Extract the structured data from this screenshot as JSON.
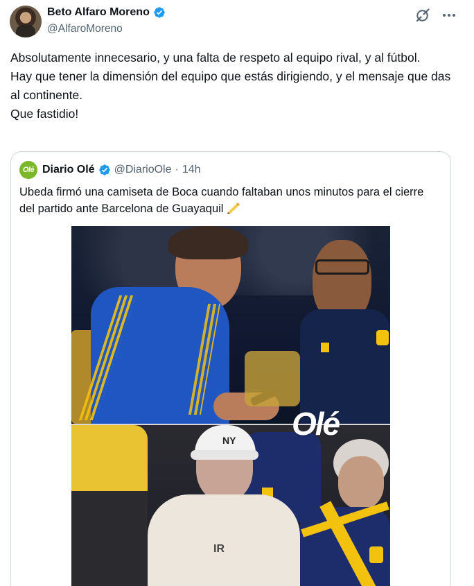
{
  "author": {
    "display_name": "Beto Alfaro Moreno",
    "handle": "@AlfaroMoreno",
    "verified": true
  },
  "tweet": {
    "lines": [
      "Absolutamente innecesario, y una falta de respeto al equipo rival, y al fútbol.",
      "Hay que tener la dimensión del equipo que estás dirigiendo, y el mensaje que das al continente.",
      "Que fastidio!"
    ]
  },
  "quote": {
    "avatar_text": "Olé",
    "display_name": "Diario Olé",
    "handle": "@DiarioOle",
    "separator": "·",
    "time": "14h",
    "text": "Ubeda firmó una camiseta de Boca cuando faltaban unos minutos para el cierre del partido ante Barcelona de Guayaquil",
    "emoji": "writing-hand",
    "media": {
      "watermark": "Olé"
    }
  },
  "icons": {
    "verified": "verified-badge-icon",
    "grok": "grok-icon",
    "more": "more-options-icon"
  },
  "colors": {
    "verified_blue": "#1d9bf0",
    "secondary_text": "#536471",
    "border": "#cfd9de",
    "ole_green": "#7ab82a",
    "boca_blue": "#1f4fb5",
    "boca_yellow": "#f2c20f"
  }
}
